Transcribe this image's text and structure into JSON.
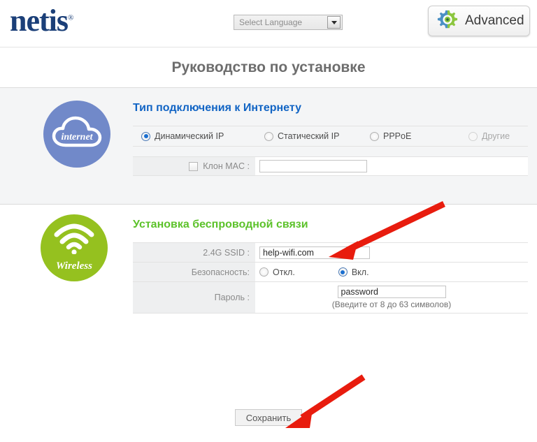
{
  "header": {
    "logo_text": "netis",
    "logo_registered": "®",
    "language_selected": "Select Language",
    "advanced_label": "Advanced",
    "gear_icon": "gear-icon",
    "caret_icon": "chevron-down-icon"
  },
  "page": {
    "title": "Руководство по установке"
  },
  "internet": {
    "badge_label": "internet",
    "badge_icon": "cloud-icon",
    "badge_color": "#7189c9",
    "heading": "Тип подключения к Интернету",
    "heading_color": "#1164c4",
    "connection_types": [
      {
        "label": "Динамический IP",
        "selected": true,
        "dimmed": false
      },
      {
        "label": "Статический IP",
        "selected": false,
        "dimmed": false
      },
      {
        "label": "PPPoE",
        "selected": false,
        "dimmed": false
      },
      {
        "label": "Другие",
        "selected": false,
        "dimmed": true
      }
    ],
    "mac_clone_label": "Клон MAC :",
    "mac_clone_checked": false,
    "mac_clone_value": ""
  },
  "wireless": {
    "badge_label": "Wireless",
    "badge_icon": "wifi-icon",
    "badge_color": "#95c11f",
    "heading": "Установка беспроводной связи",
    "heading_color": "#5cc22a",
    "ssid_label": "2.4G SSID :",
    "ssid_value": "help-wifi.com",
    "security_label": "Безопасность:",
    "security_options": [
      {
        "label": "Откл.",
        "selected": false
      },
      {
        "label": "Вкл.",
        "selected": true
      }
    ],
    "password_label": "Пароль :",
    "password_value": "password",
    "password_hint": "(Введите от 8 до 63 символов)"
  },
  "footer": {
    "save_label": "Сохранить"
  },
  "annotations": {
    "arrow_color": "#e81c0e",
    "arrow_ssid": "red-arrow-pointing-to-ssid-field",
    "arrow_save": "red-arrow-pointing-to-save-button"
  }
}
